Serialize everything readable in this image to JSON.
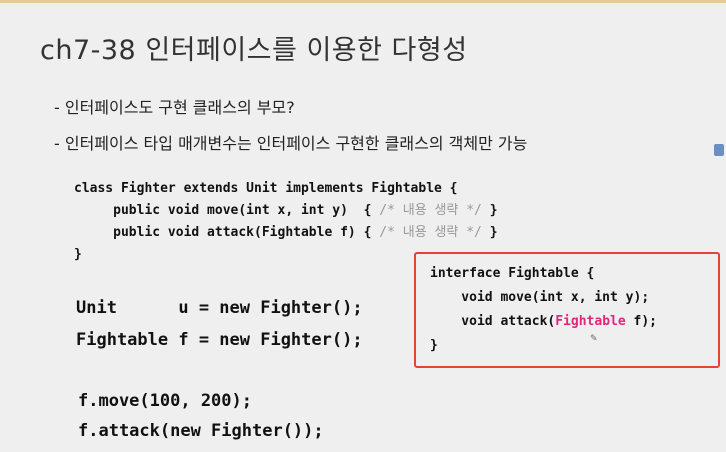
{
  "title": "ch7-38 인터페이스를 이용한 다형성",
  "bullets": [
    "- 인터페이스도 구현 클래스의 부모?",
    "- 인터페이스 타입 매개변수는 인터페이스 구현한 클래스의 객체만 가능"
  ],
  "class_code": {
    "line1": "class Fighter extends Unit implements Fightable {",
    "line2_code": "     public void move(int x, int y)  { ",
    "line2_comment": "/* 내용 생략 */",
    "line2_end": " }",
    "line3_code": "     public void attack(Fightable f) { ",
    "line3_comment": "/* 내용 생략 */",
    "line3_end": " }",
    "line4": "}"
  },
  "decl_code": {
    "line1": "Unit      u = new Fighter();",
    "line2": "Fightable f = new Fighter();"
  },
  "call_code": {
    "line1": "f.move(100, 200);",
    "line2": "f.attack(new Fighter());"
  },
  "interface_code": {
    "line1": "interface Fightable {",
    "line2": "    void move(int x, int y);",
    "line3_pre": "    void attack(",
    "line3_hl": "Fightable",
    "line3_post": " f);",
    "line4": "}"
  }
}
